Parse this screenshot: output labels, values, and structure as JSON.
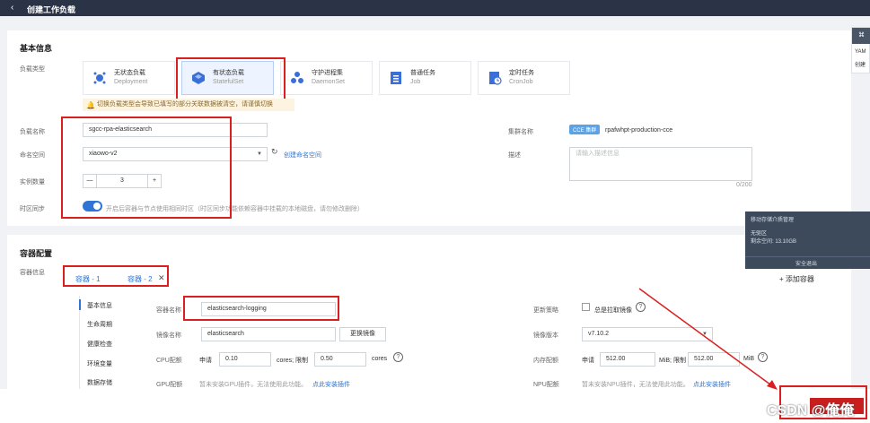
{
  "header": {
    "back_glyph": "‹",
    "title": "创建工作负载"
  },
  "basic": {
    "section_title": "基本信息",
    "type_label": "负载类型",
    "types": [
      {
        "name": "无状态负载",
        "sub": "Deployment"
      },
      {
        "name": "有状态负载",
        "sub": "StatefulSet"
      },
      {
        "name": "守护进程集",
        "sub": "DaemonSet"
      },
      {
        "name": "普通任务",
        "sub": "Job"
      },
      {
        "name": "定时任务",
        "sub": "CronJob"
      }
    ],
    "warning": "切换负载类型会导致已填写的部分关联数据被清空，请谨慎切换",
    "workload_name_label": "负载名称",
    "workload_name_value": "sgcc-rpa-elasticsearch",
    "namespace_label": "命名空间",
    "namespace_value": "xiaowo-v2",
    "create_namespace_link": "创建命名空间",
    "instances_label": "实例数量",
    "instances_minus": "—",
    "instances_value": "3",
    "instances_plus": "+",
    "timesync_label": "时区同步",
    "timesync_desc": "开启后容器与节点使用相同时区（时区同步功能依赖容器中挂载的本地磁盘，请勿修改删除）",
    "cluster_label": "集群名称",
    "cluster_badge": "CCE 集群",
    "cluster_value": "rpafwhpt-production-cce",
    "desc_label": "描述",
    "desc_placeholder": "请输入描述信息",
    "desc_counter": "0/200"
  },
  "container": {
    "section_title": "容器配置",
    "info_label": "容器信息",
    "tabs": [
      "容器 - 1",
      "容器 - 2"
    ],
    "tab_close": "✕",
    "add_container": "+ 添加容器",
    "sidebar": [
      "基本信息",
      "生命周期",
      "健康检查",
      "环境变量",
      "数据存储"
    ],
    "name_label": "容器名称",
    "name_value": "elasticsearch-logging",
    "image_label": "镜像名称",
    "image_value": "elasticsearch",
    "change_image": "更换镜像",
    "update_label": "更新策略",
    "update_desc": "总是拉取镜像",
    "version_label": "镜像版本",
    "version_value": "v7.10.2",
    "cpu_label": "CPU配额",
    "cpu_request_label": "申请",
    "cpu_request": "0.10",
    "cpu_unit_limit": "cores; 限制",
    "cpu_limit": "0.50",
    "cpu_unit": "cores",
    "mem_label": "内存配额",
    "mem_request_label": "申请",
    "mem_request": "512.00",
    "mem_unit_limit": "MiB; 限制",
    "mem_limit": "512.00",
    "mem_unit": "MiB",
    "gpu_label": "GPU配额",
    "gpu_desc": "暂未安装GPU插件，无法使用此功能。",
    "gpu_link": "点此安装插件",
    "npu_label": "NPU配额",
    "npu_desc": "暂未安装NPU插件，无法使用此功能。",
    "npu_link": "点此安装插件"
  },
  "overlay": {
    "panel_title": "移动存储介质管理",
    "panel_line1": "无驱区",
    "panel_line2": "剩余空间: 13.10GB",
    "panel_exit": "安全退出",
    "side_tab_text1": "YAM",
    "side_tab_text2": "创建"
  },
  "watermark": "CSDN @俺俺",
  "colors": {
    "accent": "#2e75d6",
    "red": "#d9201f",
    "topbar": "#2b3346"
  }
}
